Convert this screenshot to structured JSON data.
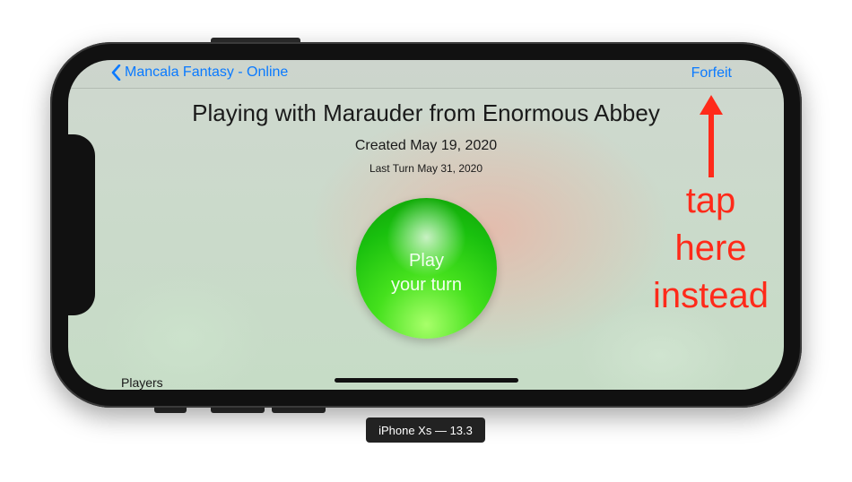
{
  "nav": {
    "back_label": "Mancala Fantasy - Online",
    "forfeit_label": "Forfeit"
  },
  "game": {
    "title": "Playing with Marauder from Enormous Abbey",
    "created": "Created May 19, 2020",
    "last_turn": "Last Turn May 31, 2020",
    "play_line1": "Play",
    "play_line2": "your turn"
  },
  "footer": {
    "players_label": "Players"
  },
  "annotation": {
    "line1": "tap",
    "line2": "here",
    "line3": "instead",
    "color": "#ff2a1a"
  },
  "simulator": {
    "device_label": "iPhone Xs — 13.3"
  },
  "colors": {
    "accent": "#0a7aff",
    "play_green": "#19c00e"
  }
}
